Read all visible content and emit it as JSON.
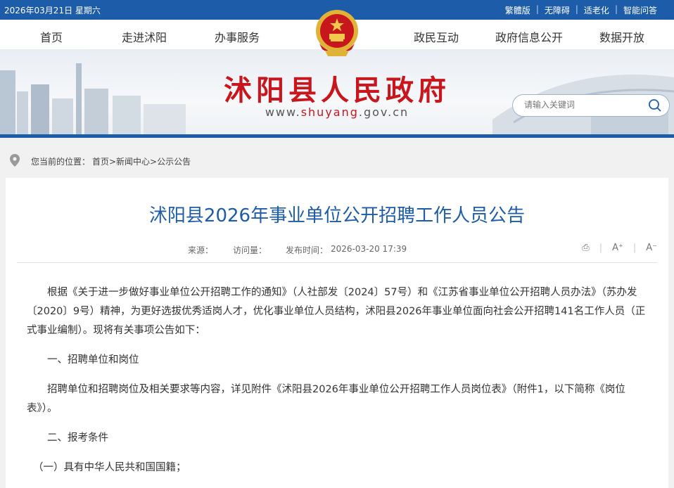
{
  "topbar": {
    "date": "2026年03月21日 星期六",
    "links": [
      "繁體版",
      "无障碍",
      "适老化",
      "智能问答"
    ]
  },
  "nav": {
    "items": [
      "首页",
      "走进沭阳",
      "办事服务",
      "政民互动",
      "政府信息公开",
      "数据开放"
    ]
  },
  "banner": {
    "title": "沭阳县人民政府",
    "url_pre": "www.",
    "url_mid": "shuyang",
    "url_post": ".gov.cn"
  },
  "search": {
    "placeholder": "请输入关键词"
  },
  "breadcrumb": {
    "label": "您当前的位置：",
    "path": "首页>新闻中心>公示公告"
  },
  "article": {
    "title": "沭阳县2026年事业单位公开招聘工作人员公告",
    "source_label": "来源：",
    "visits_label": "访问量：",
    "published_label": "发布时间：",
    "published_value": "2026-03-20 17:39",
    "tools": {
      "print": "⎙",
      "font_up": "A⁺",
      "font_down": "A⁻"
    },
    "paragraphs": [
      "根据《关于进一步做好事业单位公开招聘工作的通知》（人社部发〔2024〕57号）和《江苏省事业单位公开招聘人员办法》（苏办发〔2020〕9号）精神，为更好选拔优秀适岗人才，优化事业单位人员结构，沭阳县2026年事业单位面向社会公开招聘141名工作人员（正式事业编制）。现将有关事项公告如下：",
      "一、招聘单位和岗位",
      "招聘单位和招聘岗位及相关要求等内容，详见附件《沭阳县2026年事业单位公开招聘工作人员岗位表》（附件1，以下简称《岗位表》）。",
      "二、报考条件",
      "（一）具有中华人民共和国国籍；"
    ]
  },
  "colors": {
    "primary": "#1d5ca8",
    "brand_red": "#c8161d",
    "gold": "#f2c94c"
  }
}
